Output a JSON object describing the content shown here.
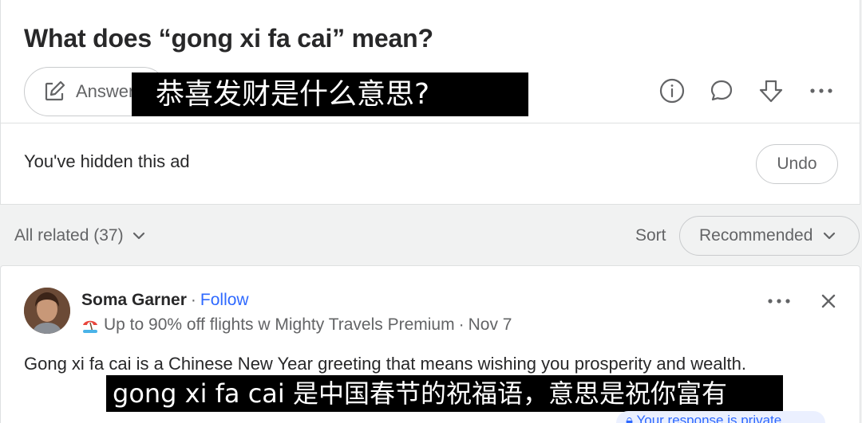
{
  "question": {
    "title": "What does “gong xi fa cai” mean?",
    "answer_button_label": "Answer",
    "title_overlay": "恭喜发财是什么意思?"
  },
  "ad": {
    "hidden_text": "You've hidden this ad",
    "undo_label": "Undo"
  },
  "related": {
    "label": "All related (37)",
    "sort_label": "Sort",
    "sort_value": "Recommended"
  },
  "answer": {
    "author": "Soma Garner",
    "separator": "·",
    "follow_label": "Follow",
    "credential": "Up to 90% off flights w Mighty Travels Premium",
    "date": "Nov 7",
    "text": "Gong xi fa cai is a Chinese New Year greeting that means wishing you prosperity and wealth.",
    "subtitle_overlay": "gong xi fa cai 是中国春节的祝福语，意思是祝你富有",
    "private_note": "Your response is private"
  },
  "icons": [
    "pencil-icon",
    "info-icon",
    "comment-icon",
    "downvote-icon",
    "more-icon",
    "chevron-down-icon",
    "close-icon",
    "lock-icon"
  ],
  "colors": {
    "accent": "#2e69ff",
    "text": "#282829",
    "muted": "#636466",
    "border": "#dee0e1",
    "background": "#f1f2f2"
  }
}
